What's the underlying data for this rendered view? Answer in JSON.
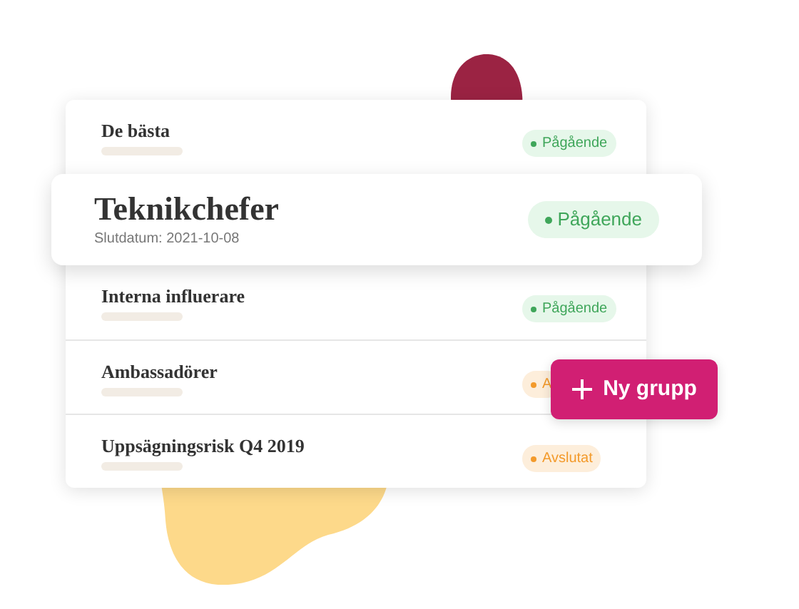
{
  "groups": [
    {
      "name": "De bästa",
      "selected": false,
      "status": {
        "kind": "ongoing",
        "label": "Pågående"
      }
    },
    {
      "name": "Teknikchefer",
      "selected": true,
      "end_date": "Slutdatum: 2021-10-08",
      "status": {
        "kind": "ongoing",
        "label": "Pågående"
      }
    },
    {
      "name": "Interna influerare",
      "selected": false,
      "status": {
        "kind": "ongoing",
        "label": "Pågående"
      }
    },
    {
      "name": "Ambassadörer",
      "selected": false,
      "status": {
        "kind": "ended",
        "label": "A"
      }
    },
    {
      "name": "Uppsägningsrisk Q4 2019",
      "selected": false,
      "status": {
        "kind": "ended",
        "label": "Avslutat"
      }
    }
  ],
  "new_group_button": {
    "label": "Ny grupp"
  }
}
